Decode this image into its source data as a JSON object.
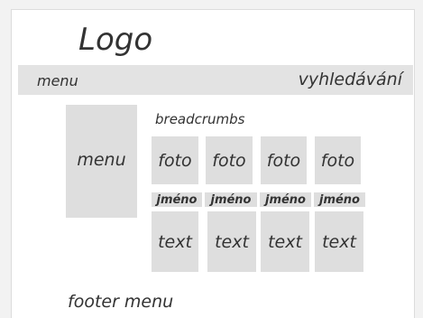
{
  "header": {
    "logo": "Logo"
  },
  "topbar": {
    "menu": "menu",
    "search": "vyhledávání"
  },
  "sidebar": {
    "menu": "menu"
  },
  "main": {
    "breadcrumbs": "breadcrumbs",
    "items": [
      {
        "photo": "foto",
        "name": "jméno",
        "text": "text"
      },
      {
        "photo": "foto",
        "name": "jméno",
        "text": "text"
      },
      {
        "photo": "foto",
        "name": "jméno",
        "text": "text"
      },
      {
        "photo": "foto",
        "name": "jméno",
        "text": "text"
      }
    ]
  },
  "footer": {
    "menu": "footer menu"
  },
  "colors": {
    "page_background": "#f2f2f2",
    "placeholder_fill": "#dedede",
    "text": "#333333"
  }
}
